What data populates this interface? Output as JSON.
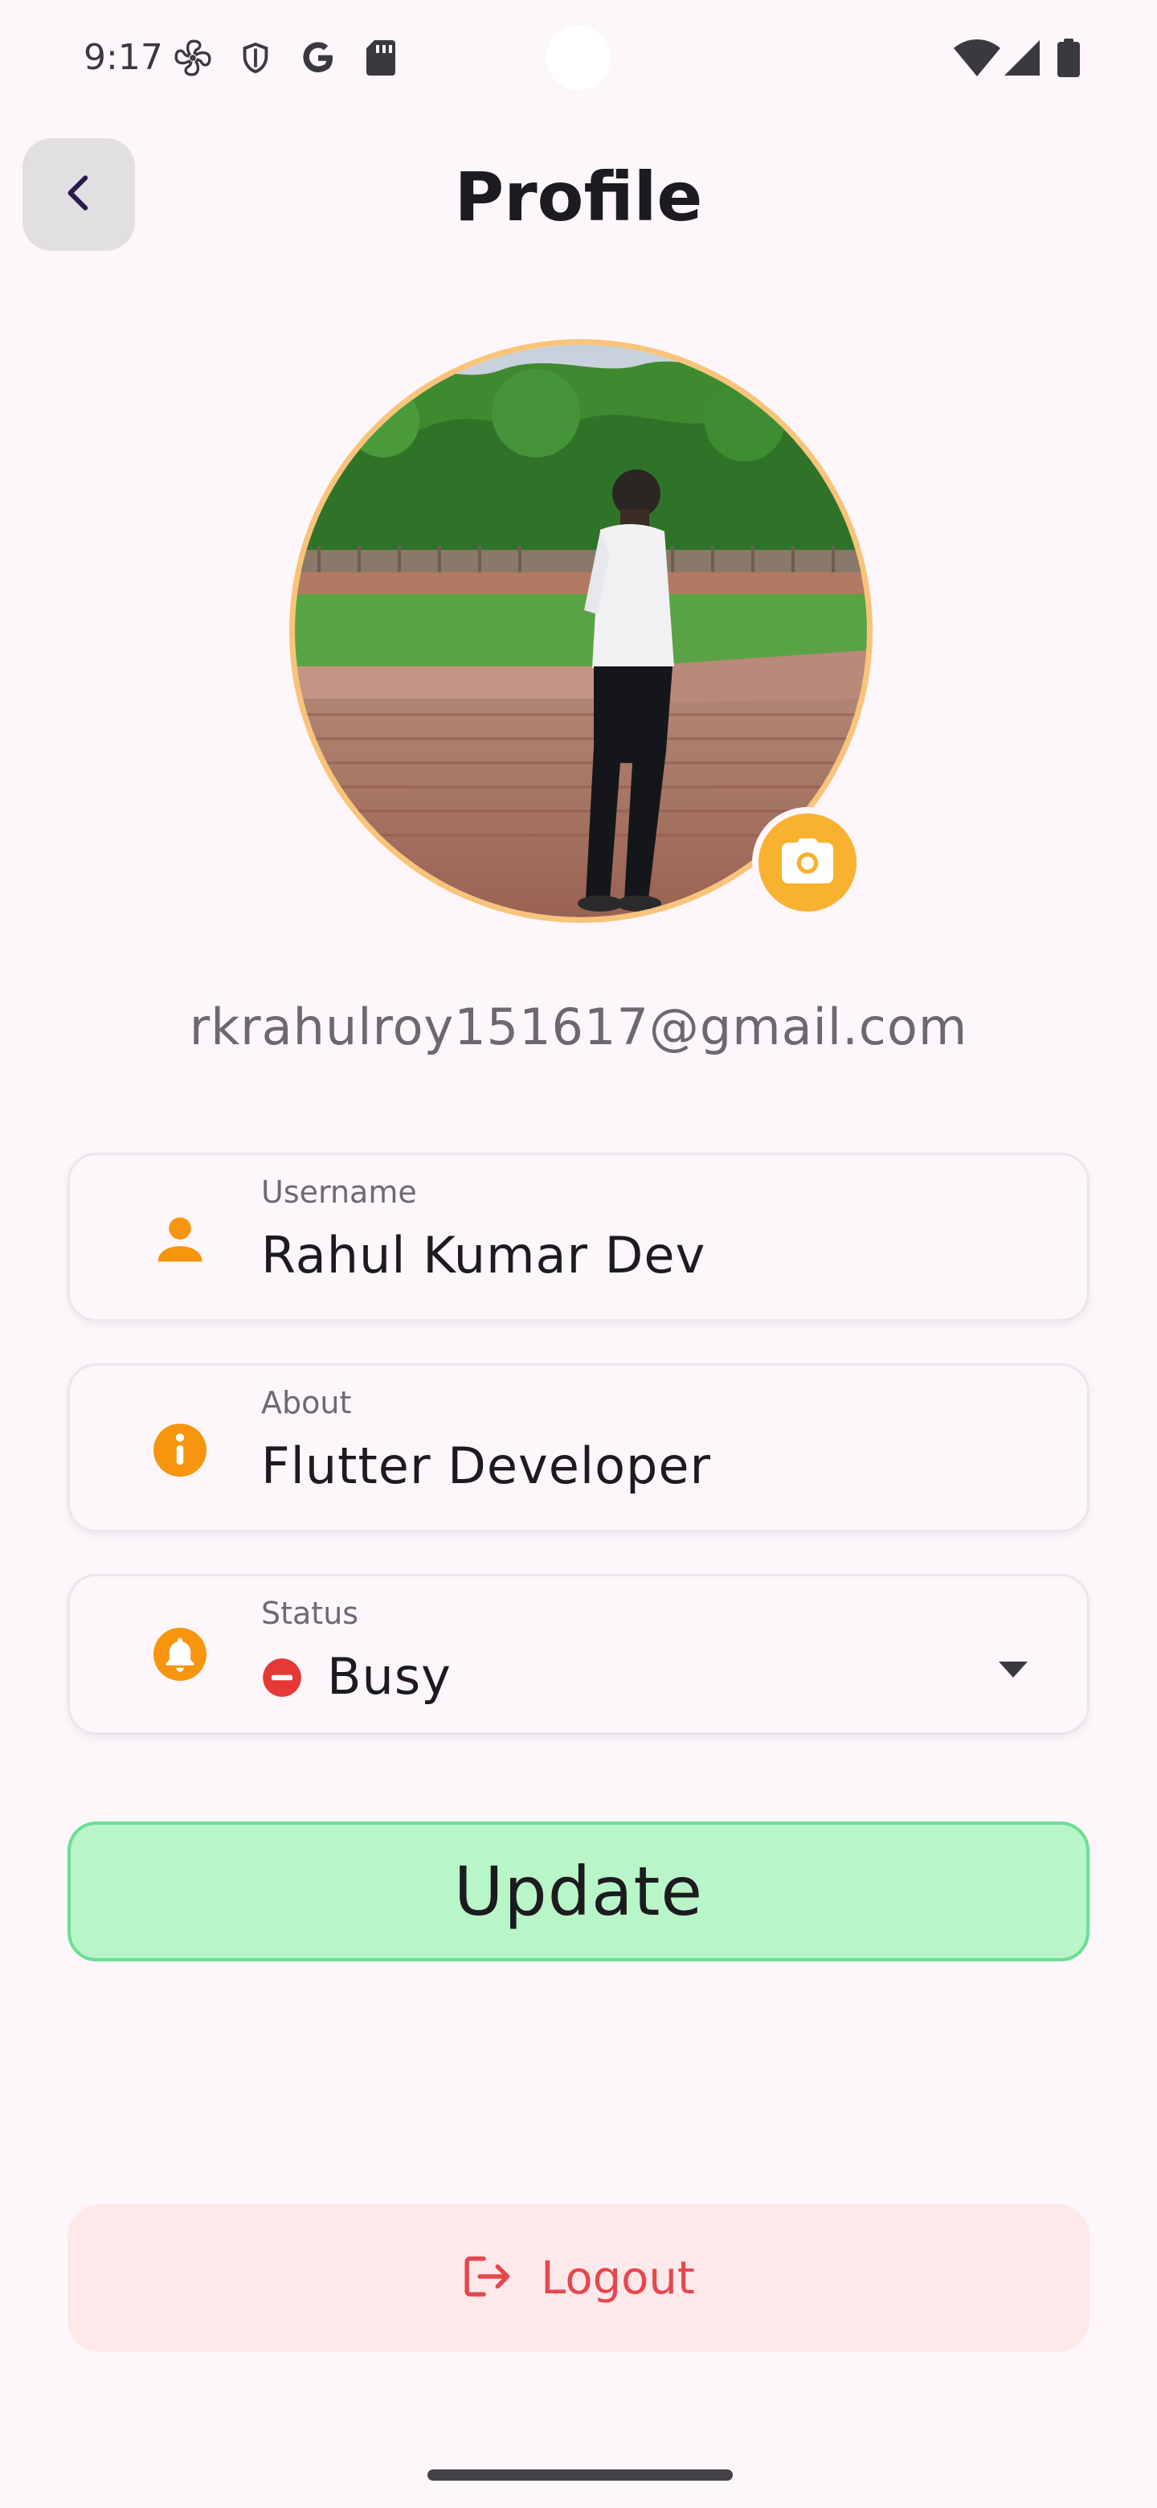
{
  "status_bar": {
    "time": "9:17",
    "left_icons": [
      "fan-icon",
      "shield-icon",
      "google-icon",
      "sd-card-icon"
    ],
    "right_icons": [
      "wifi-icon",
      "signal-icon",
      "battery-icon"
    ]
  },
  "header": {
    "title": "Profile",
    "back_icon": "chevron-left-icon"
  },
  "profile": {
    "avatar": "profile-photo",
    "camera_icon": "camera-icon",
    "email": "rkrahulroy151617@gmail.com"
  },
  "fields": {
    "username": {
      "label": "Username",
      "value": "Rahul Kumar Dev",
      "icon": "person-icon"
    },
    "about": {
      "label": "About",
      "value": "Flutter Developer",
      "icon": "info-icon"
    },
    "status": {
      "label": "Status",
      "value": "Busy",
      "icon": "bell-icon",
      "status_icon": "do-not-disturb-icon",
      "dropdown_icon": "dropdown-arrow-icon"
    }
  },
  "actions": {
    "update_label": "Update",
    "logout_label": "Logout",
    "logout_icon": "logout-icon"
  },
  "colors": {
    "background": "#fdf6fb",
    "accent": "#f9a61a",
    "update_bg": "#b8f5c9",
    "update_border": "#6ddd93",
    "logout_bg": "#fde8ea",
    "logout_text": "#e5484d",
    "busy_red": "#e53935"
  }
}
